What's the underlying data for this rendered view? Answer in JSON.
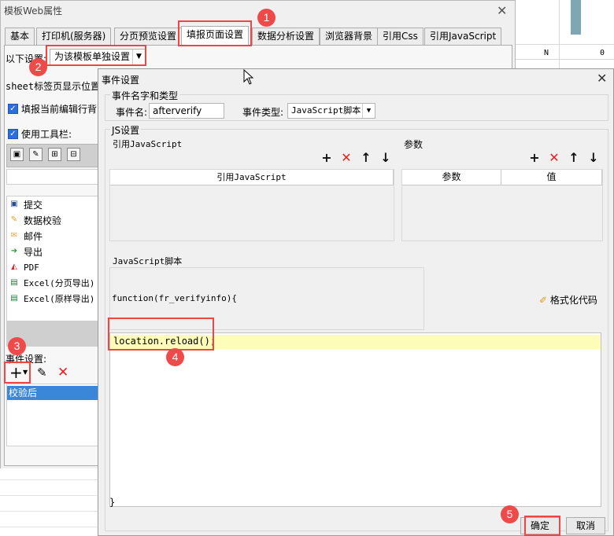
{
  "sheet": {
    "cell_n": "N",
    "cell_0": "0"
  },
  "outer": {
    "title": "模板Web属性",
    "tabs": [
      "基本",
      "打印机(服务器)",
      "分页预览设置",
      "填报页面设置",
      "数据分析设置",
      "浏览器背景",
      "引用Css",
      "引用JavaScript"
    ],
    "below_settings_label": "以下设置:",
    "below_settings_value": "为该模板单独设置",
    "sheet_pos_label": "sheet标签页显示位置:",
    "cb_fill_label": "填报当前编辑行背",
    "cb_toolbar_label": "使用工具栏:",
    "buttons": [
      "提交",
      "数据校验",
      "邮件",
      "导出",
      "PDF",
      "Excel(分页导出)",
      "Excel(原样导出)"
    ],
    "event_label": "事件设置:",
    "event_item": "校验后"
  },
  "inner": {
    "title": "事件设置",
    "group_name_type": "事件名字和类型",
    "event_name_label": "事件名:",
    "event_name_value": "afterverify",
    "event_type_label": "事件类型:",
    "event_type_value": "JavaScript脚本",
    "group_js": "JS设置",
    "ref_js_label": "引用JavaScript",
    "ref_js_header": "引用JavaScript",
    "params_label": "参数",
    "params_header_param": "参数",
    "params_header_value": "值",
    "script_label": "JavaScript脚本",
    "function_header": "function(fr_verifyinfo){",
    "format_code": "格式化代码",
    "code_line": "location.reload();",
    "closing_brace": "}",
    "ok_button": "确定",
    "cancel_button": "取消"
  },
  "annotations": [
    "1",
    "2",
    "3",
    "4",
    "5"
  ],
  "colors": {
    "annotation": "#ee4545",
    "selection": "#3a86d8",
    "code_highlight": "#fdfcb9"
  }
}
